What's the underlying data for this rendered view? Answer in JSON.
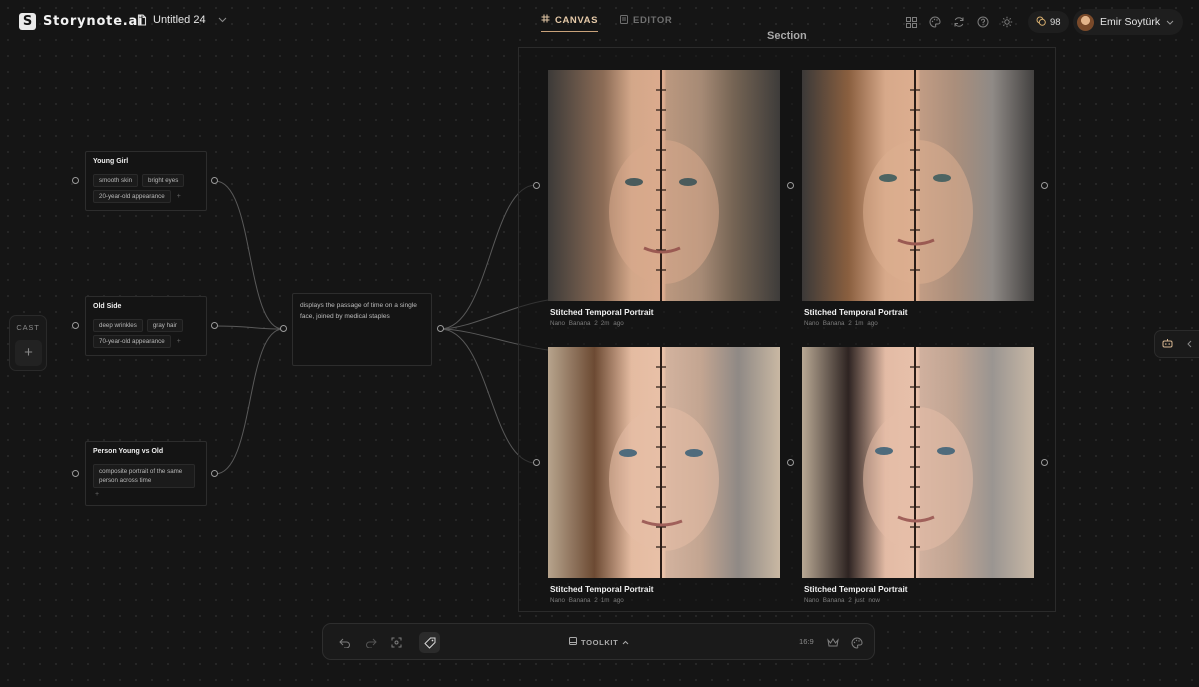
{
  "app": {
    "name": "Storynote.ai",
    "logo_glyph": "S"
  },
  "document": {
    "title": "Untitled 24"
  },
  "tabs": [
    {
      "label": "CANVAS",
      "active": true
    },
    {
      "label": "EDITOR",
      "active": false
    }
  ],
  "header_icons": [
    "grid-icon",
    "palette-icon",
    "refresh-icon",
    "help-icon",
    "sun-icon"
  ],
  "credits": {
    "count": "98"
  },
  "user": {
    "name": "Emir Soytürk"
  },
  "cast": {
    "label": "CAST",
    "add": "+"
  },
  "nodes": [
    {
      "title": "Young Girl",
      "tags": [
        "smooth skin",
        "bright eyes",
        "20-year-old appearance"
      ],
      "add": "+"
    },
    {
      "title": "Old Side",
      "tags": [
        "deep wrinkles",
        "gray hair",
        "70-year-old appearance"
      ],
      "add": "+"
    },
    {
      "title": "Person Young vs Old",
      "tags": [
        "composite portrait of the same person across time"
      ],
      "add": "+"
    }
  ],
  "prompt_node": {
    "text": "displays the passage of time on a single face, joined by medical staples"
  },
  "section": {
    "label": "Section"
  },
  "cards": [
    {
      "title": "Stitched Temporal Portrait",
      "model": "Nano Banana 2",
      "time": "2m ago"
    },
    {
      "title": "Stitched Temporal Portrait",
      "model": "Nano Banana 2",
      "time": "1m ago"
    },
    {
      "title": "Stitched Temporal Portrait",
      "model": "Nano Banana 2",
      "time": "1m ago"
    },
    {
      "title": "Stitched Temporal Portrait",
      "model": "Nano Banana 2",
      "time": "just now"
    }
  ],
  "toolbar": {
    "toolkit_label": "TOOLKIT",
    "ratio": "16:9"
  },
  "colors": {
    "accent": "#c9a27a",
    "background": "#151515",
    "panel": "#141414"
  }
}
